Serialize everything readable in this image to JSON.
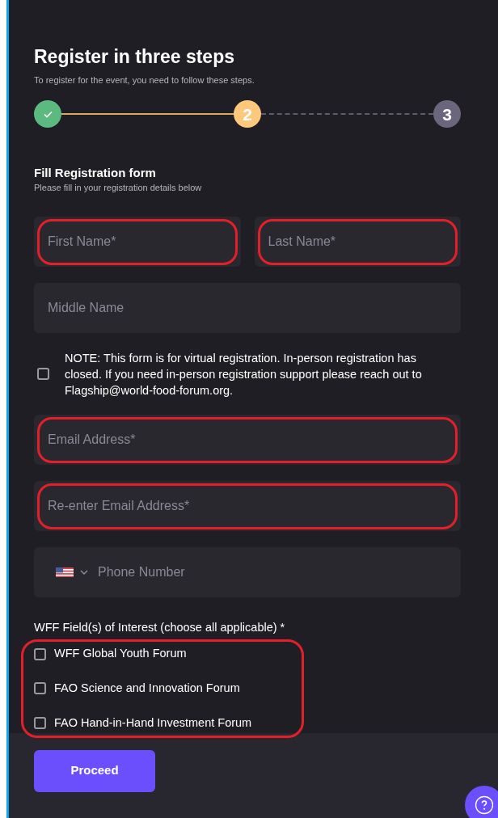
{
  "title": "Register in three steps",
  "subtitle": "To register for the event, you need to follow these steps.",
  "steps": [
    {
      "done": true,
      "current": false
    },
    {
      "done": false,
      "current": true,
      "label": "2"
    },
    {
      "done": false,
      "current": false,
      "label": "3"
    }
  ],
  "section": {
    "title": "Fill Registration form",
    "subtitle": "Please fill in your registration details below"
  },
  "name_fields": [
    {
      "placeholder": "First Name*",
      "marked": true
    },
    {
      "placeholder": "Last Name*",
      "marked": true
    }
  ],
  "middle_name": {
    "placeholder": "Middle Name"
  },
  "note": {
    "checked": false,
    "text": "NOTE: This form is for virtual registration. In-person registration has closed. If you need in-person registration support please reach out to Flagship@world-food-forum.org."
  },
  "email_fields": [
    {
      "placeholder": "Email Address*",
      "marked": true
    },
    {
      "placeholder": "Re-enter Email Address*",
      "marked": true
    }
  ],
  "phone": {
    "placeholder": "Phone Number"
  },
  "interests": {
    "label": "WFF Field(s) of Interest (choose all applicable) *",
    "marked": true,
    "options": [
      {
        "label": "WFF Global Youth Forum",
        "checked": false
      },
      {
        "label": "FAO Science and Innovation Forum",
        "checked": false
      },
      {
        "label": "FAO Hand-in-Hand Investment Forum",
        "checked": false
      }
    ]
  },
  "proceed_button": "Proceed"
}
